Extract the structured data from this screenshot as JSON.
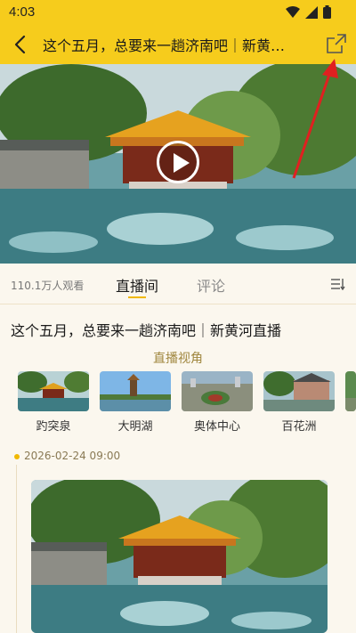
{
  "status": {
    "time": "4:03"
  },
  "header": {
    "title": "这个五月，总要来一趟济南吧｜新黄…"
  },
  "viewers": "110.1万人观看",
  "tabs": [
    {
      "label": "直播间"
    },
    {
      "label": "评论"
    }
  ],
  "live_title": "这个五月，总要来一趟济南吧｜新黄河直播",
  "views_section_label": "直播视角",
  "views": [
    {
      "label": "趵突泉"
    },
    {
      "label": "大明湖"
    },
    {
      "label": "奥体中心"
    },
    {
      "label": "百花洲"
    }
  ],
  "post": {
    "time": "2026-02-24 09:00"
  },
  "colors": {
    "accent": "#f6cc1c",
    "arrow": "#e02020"
  }
}
